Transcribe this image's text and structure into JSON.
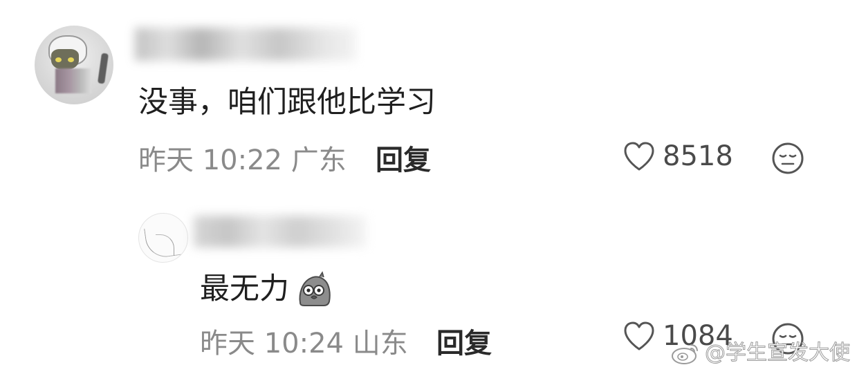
{
  "comments": [
    {
      "content": "没事，咱们跟他比学习",
      "time": "昨天 10:22",
      "location": "广东",
      "reply_label": "回复",
      "likes": "8518"
    },
    {
      "content": "最无力",
      "time": "昨天 10:24",
      "location": "山东",
      "reply_label": "回复",
      "likes": "1084"
    }
  ],
  "icons": {
    "like": "heart-outline-icon",
    "emoji": "unamused-face-icon",
    "inline_emoji": "shocked-pigeon-emoji"
  },
  "watermark": {
    "text": "@学生宣发大使",
    "logo": "weibo-logo"
  },
  "colors": {
    "meta_text": "#8a8a8a",
    "content_text": "#1f1f1f",
    "icon_stroke": "#555555"
  }
}
